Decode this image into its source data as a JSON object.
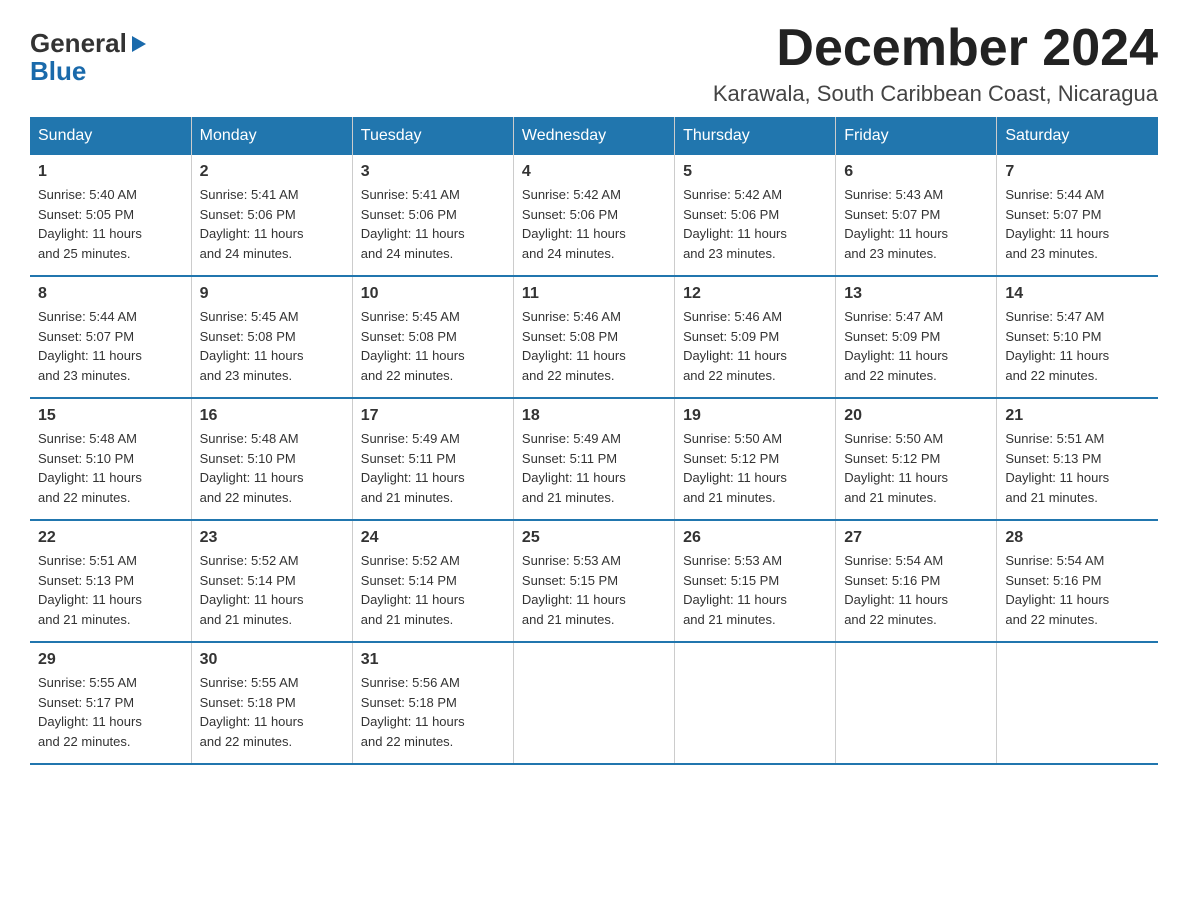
{
  "header": {
    "logo_general": "General",
    "logo_blue": "Blue",
    "month_title": "December 2024",
    "location": "Karawala, South Caribbean Coast, Nicaragua"
  },
  "weekdays": [
    "Sunday",
    "Monday",
    "Tuesday",
    "Wednesday",
    "Thursday",
    "Friday",
    "Saturday"
  ],
  "weeks": [
    [
      {
        "day": "1",
        "sunrise": "5:40 AM",
        "sunset": "5:05 PM",
        "daylight": "11 hours and 25 minutes."
      },
      {
        "day": "2",
        "sunrise": "5:41 AM",
        "sunset": "5:06 PM",
        "daylight": "11 hours and 24 minutes."
      },
      {
        "day": "3",
        "sunrise": "5:41 AM",
        "sunset": "5:06 PM",
        "daylight": "11 hours and 24 minutes."
      },
      {
        "day": "4",
        "sunrise": "5:42 AM",
        "sunset": "5:06 PM",
        "daylight": "11 hours and 24 minutes."
      },
      {
        "day": "5",
        "sunrise": "5:42 AM",
        "sunset": "5:06 PM",
        "daylight": "11 hours and 23 minutes."
      },
      {
        "day": "6",
        "sunrise": "5:43 AM",
        "sunset": "5:07 PM",
        "daylight": "11 hours and 23 minutes."
      },
      {
        "day": "7",
        "sunrise": "5:44 AM",
        "sunset": "5:07 PM",
        "daylight": "11 hours and 23 minutes."
      }
    ],
    [
      {
        "day": "8",
        "sunrise": "5:44 AM",
        "sunset": "5:07 PM",
        "daylight": "11 hours and 23 minutes."
      },
      {
        "day": "9",
        "sunrise": "5:45 AM",
        "sunset": "5:08 PM",
        "daylight": "11 hours and 23 minutes."
      },
      {
        "day": "10",
        "sunrise": "5:45 AM",
        "sunset": "5:08 PM",
        "daylight": "11 hours and 22 minutes."
      },
      {
        "day": "11",
        "sunrise": "5:46 AM",
        "sunset": "5:08 PM",
        "daylight": "11 hours and 22 minutes."
      },
      {
        "day": "12",
        "sunrise": "5:46 AM",
        "sunset": "5:09 PM",
        "daylight": "11 hours and 22 minutes."
      },
      {
        "day": "13",
        "sunrise": "5:47 AM",
        "sunset": "5:09 PM",
        "daylight": "11 hours and 22 minutes."
      },
      {
        "day": "14",
        "sunrise": "5:47 AM",
        "sunset": "5:10 PM",
        "daylight": "11 hours and 22 minutes."
      }
    ],
    [
      {
        "day": "15",
        "sunrise": "5:48 AM",
        "sunset": "5:10 PM",
        "daylight": "11 hours and 22 minutes."
      },
      {
        "day": "16",
        "sunrise": "5:48 AM",
        "sunset": "5:10 PM",
        "daylight": "11 hours and 22 minutes."
      },
      {
        "day": "17",
        "sunrise": "5:49 AM",
        "sunset": "5:11 PM",
        "daylight": "11 hours and 21 minutes."
      },
      {
        "day": "18",
        "sunrise": "5:49 AM",
        "sunset": "5:11 PM",
        "daylight": "11 hours and 21 minutes."
      },
      {
        "day": "19",
        "sunrise": "5:50 AM",
        "sunset": "5:12 PM",
        "daylight": "11 hours and 21 minutes."
      },
      {
        "day": "20",
        "sunrise": "5:50 AM",
        "sunset": "5:12 PM",
        "daylight": "11 hours and 21 minutes."
      },
      {
        "day": "21",
        "sunrise": "5:51 AM",
        "sunset": "5:13 PM",
        "daylight": "11 hours and 21 minutes."
      }
    ],
    [
      {
        "day": "22",
        "sunrise": "5:51 AM",
        "sunset": "5:13 PM",
        "daylight": "11 hours and 21 minutes."
      },
      {
        "day": "23",
        "sunrise": "5:52 AM",
        "sunset": "5:14 PM",
        "daylight": "11 hours and 21 minutes."
      },
      {
        "day": "24",
        "sunrise": "5:52 AM",
        "sunset": "5:14 PM",
        "daylight": "11 hours and 21 minutes."
      },
      {
        "day": "25",
        "sunrise": "5:53 AM",
        "sunset": "5:15 PM",
        "daylight": "11 hours and 21 minutes."
      },
      {
        "day": "26",
        "sunrise": "5:53 AM",
        "sunset": "5:15 PM",
        "daylight": "11 hours and 21 minutes."
      },
      {
        "day": "27",
        "sunrise": "5:54 AM",
        "sunset": "5:16 PM",
        "daylight": "11 hours and 22 minutes."
      },
      {
        "day": "28",
        "sunrise": "5:54 AM",
        "sunset": "5:16 PM",
        "daylight": "11 hours and 22 minutes."
      }
    ],
    [
      {
        "day": "29",
        "sunrise": "5:55 AM",
        "sunset": "5:17 PM",
        "daylight": "11 hours and 22 minutes."
      },
      {
        "day": "30",
        "sunrise": "5:55 AM",
        "sunset": "5:18 PM",
        "daylight": "11 hours and 22 minutes."
      },
      {
        "day": "31",
        "sunrise": "5:56 AM",
        "sunset": "5:18 PM",
        "daylight": "11 hours and 22 minutes."
      },
      null,
      null,
      null,
      null
    ]
  ],
  "labels": {
    "sunrise": "Sunrise:",
    "sunset": "Sunset:",
    "daylight": "Daylight:"
  }
}
